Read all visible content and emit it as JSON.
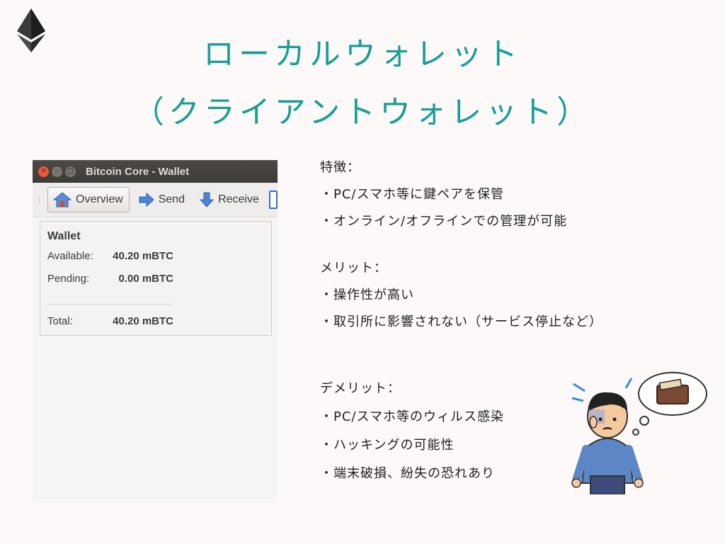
{
  "slide": {
    "title_line1": "ローカルウォレット",
    "title_line2": "（クライアントウォレット）"
  },
  "window": {
    "title": "Bitcoin Core - Wallet",
    "toolbar": {
      "overview": "Overview",
      "send": "Send",
      "receive": "Receive"
    },
    "wallet": {
      "heading": "Wallet",
      "available_label": "Available:",
      "available_value": "40.20 mBTC",
      "pending_label": "Pending:",
      "pending_value": "0.00 mBTC",
      "total_label": "Total:",
      "total_value": "40.20 mBTC"
    }
  },
  "features": {
    "heading": "特徴：",
    "items": [
      "・PC/スマホ等に鍵ペアを保管",
      "・オンライン/オフラインでの管理が可能"
    ]
  },
  "merits": {
    "heading": "メリット：",
    "items": [
      "・操作性が高い",
      "・取引所に影響されない（サービス停止など）"
    ]
  },
  "demerits": {
    "heading": "デメリット：",
    "items": [
      "・PC/スマホ等のウィルス感染",
      "・ハッキングの可能性",
      "・端末破損、紛失の恐れあり"
    ]
  }
}
